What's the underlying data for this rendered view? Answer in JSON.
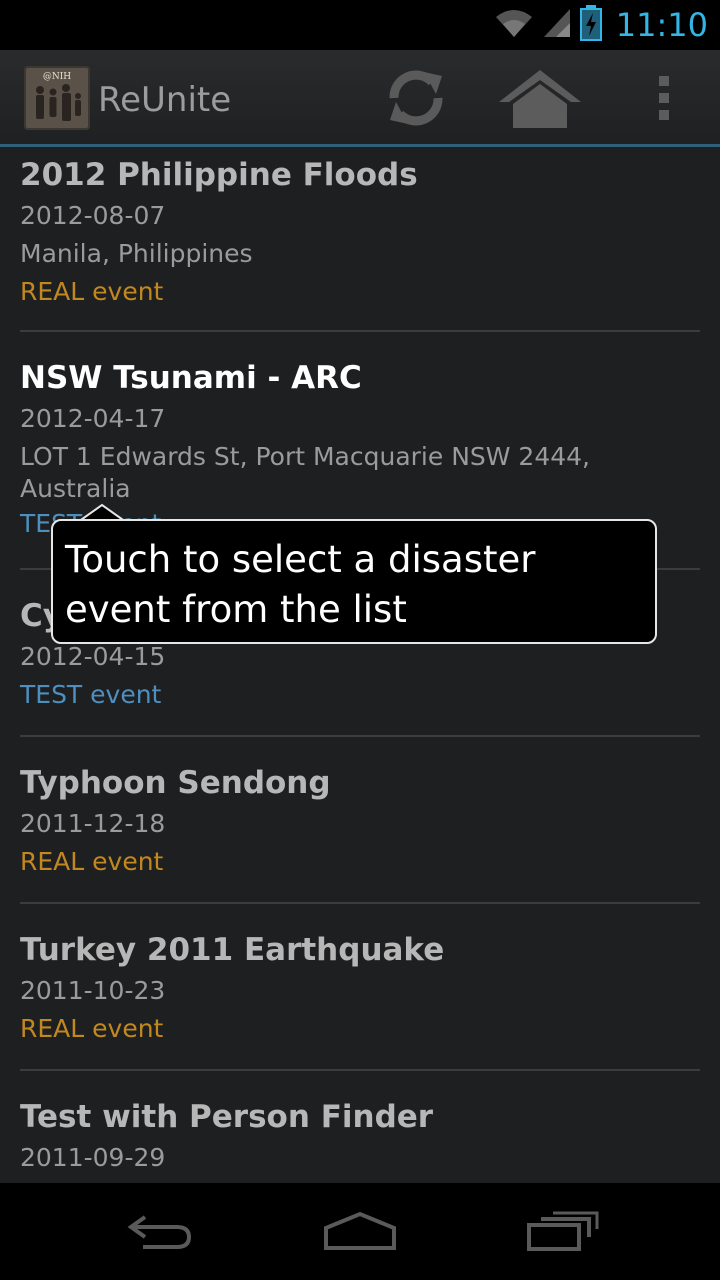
{
  "status_bar": {
    "time": "11:10",
    "icons": [
      "wifi-icon",
      "signal-icon",
      "battery-charging-icon"
    ]
  },
  "action_bar": {
    "app_icon_text": "@NIH",
    "title": "ReUnite",
    "actions": [
      "refresh-icon",
      "home-icon",
      "overflow-menu-icon"
    ]
  },
  "events": [
    {
      "title": "2012 Philippine Floods",
      "date": "2012-08-07",
      "location": "Manila, Philippines",
      "type": "REAL event"
    },
    {
      "title": "NSW Tsunami - ARC",
      "date": "2012-04-17",
      "location": "LOT 1 Edwards St, Port Macquarie NSW 2444, Australia",
      "type": "TEST event"
    },
    {
      "title": "Cy",
      "date": "2012-04-15",
      "location": "",
      "type": "TEST event"
    },
    {
      "title": "Typhoon Sendong",
      "date": "2011-12-18",
      "location": "",
      "type": "REAL event"
    },
    {
      "title": "Turkey 2011 Earthquake",
      "date": "2011-10-23",
      "location": "",
      "type": "REAL event"
    },
    {
      "title": "Test with Person Finder",
      "date": "2011-09-29",
      "location": "",
      "type": ""
    }
  ],
  "tooltip": {
    "text": "Touch to select a disaster event from the list"
  },
  "nav_bar": {
    "buttons": [
      "back-icon",
      "home-nav-icon",
      "recent-apps-icon"
    ]
  },
  "colors": {
    "accent": "#33b5e5",
    "real_event": "#c28820",
    "test_event": "#4d8fbf"
  }
}
